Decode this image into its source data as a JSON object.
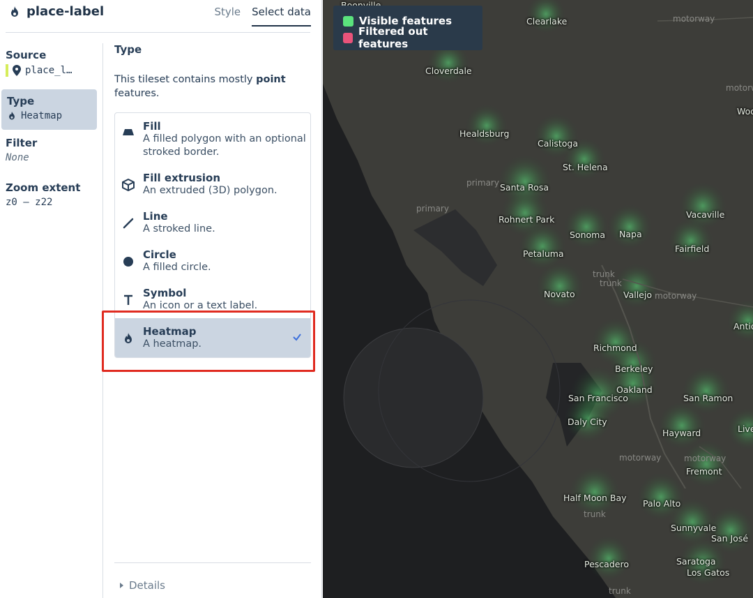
{
  "header": {
    "layer_name": "place-label",
    "tabs": [
      "Style",
      "Select data"
    ]
  },
  "sidebar": {
    "source_label": "Source",
    "source_value": "place_l…",
    "type_label": "Type",
    "type_value": "Heatmap",
    "filter_label": "Filter",
    "filter_value": "None",
    "zoom_label": "Zoom extent",
    "zoom_value": "z0 – z22"
  },
  "main": {
    "title": "Type",
    "desc_prefix": "This tileset contains mostly ",
    "desc_bold": "point",
    "desc_suffix": " features.",
    "types": [
      {
        "name": "Fill",
        "desc": "A filled polygon with an optional stroked border.",
        "icon": "fill-icon"
      },
      {
        "name": "Fill extrusion",
        "desc": "An extruded (3D) polygon.",
        "icon": "extrusion-icon"
      },
      {
        "name": "Line",
        "desc": "A stroked line.",
        "icon": "line-icon"
      },
      {
        "name": "Circle",
        "desc": "A filled circle.",
        "icon": "circle-icon"
      },
      {
        "name": "Symbol",
        "desc": "An icon or a text label.",
        "icon": "symbol-icon"
      },
      {
        "name": "Heatmap",
        "desc": "A heatmap.",
        "icon": "heatmap-icon",
        "selected": true
      }
    ],
    "details_label": "Details"
  },
  "legend": {
    "visible": "Visible features",
    "filtered": "Filtered out features",
    "visible_color": "#5be37d",
    "filtered_color": "#e9537a"
  },
  "map": {
    "places": [
      "Boonville",
      "Clearlake",
      "Cloverdale",
      "Healdsburg",
      "Calistoga",
      "St. Helena",
      "Santa Rosa",
      "Rohnert Park",
      "Sonoma",
      "Napa",
      "Vacaville",
      "Fairfield",
      "Petaluma",
      "Novato",
      "Vallejo",
      "Antioch",
      "Richmond",
      "Berkeley",
      "Oakland",
      "San Francisco",
      "San Ramon",
      "Daly City",
      "Hayward",
      "Livermore",
      "Fremont",
      "Half Moon Bay",
      "Palo Alto",
      "Sunnyvale",
      "San José",
      "Saratoga",
      "Los Gatos",
      "Pescadero",
      "Woodland"
    ],
    "roads": [
      "motorway",
      "motorway",
      "primary",
      "primary",
      "trunk",
      "trunk",
      "motorway",
      "motorway",
      "trunk",
      "motorway",
      "trunk"
    ]
  }
}
